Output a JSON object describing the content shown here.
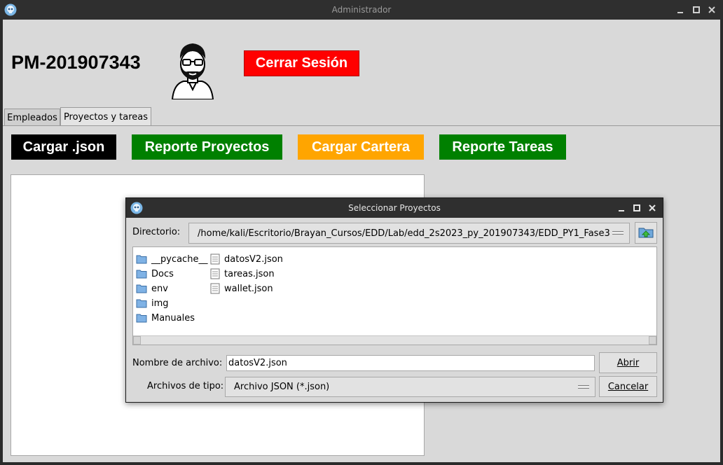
{
  "window": {
    "title": "Administrador"
  },
  "header": {
    "user_id": "PM-201907343",
    "logout_label": "Cerrar Sesión"
  },
  "tabs": [
    {
      "label": "Empleados",
      "active": false
    },
    {
      "label": "Proyectos y tareas",
      "active": true
    }
  ],
  "actions": {
    "load_json": "Cargar .json",
    "report_projects": "Reporte Proyectos",
    "load_wallet": "Cargar Cartera",
    "report_tasks": "Reporte Tareas"
  },
  "colors": {
    "logout": "#ff0000",
    "load_json": "#000000",
    "report_projects": "#008000",
    "load_wallet": "#ffa500",
    "report_tasks": "#008000"
  },
  "dialog": {
    "title": "Seleccionar Proyectos",
    "directory_label": "Directorio:",
    "directory_value": "/home/kali/Escritorio/Brayan_Cursos/EDD/Lab/edd_2s2023_py_201907343/EDD_PY1_Fase3",
    "folders": [
      "__pycache__",
      "Docs",
      "env",
      "img",
      "Manuales"
    ],
    "files": [
      "datosV2.json",
      "tareas.json",
      "wallet.json"
    ],
    "filename_label": "Nombre de archivo:",
    "filename_value": "datosV2.json",
    "filetype_label": "Archivos de tipo:",
    "filetype_value": "Archivo JSON (*.json)",
    "open_label": "Abrir",
    "cancel_label": "Cancelar"
  }
}
